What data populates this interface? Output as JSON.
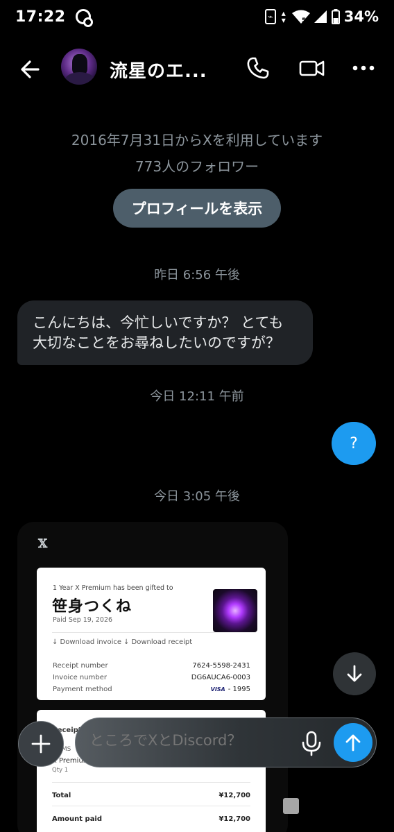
{
  "status_bar": {
    "time": "17:22",
    "network_badge": "5",
    "battery_label": "34%"
  },
  "header": {
    "title": "流星のエ...",
    "back_icon": "arrow-left-icon",
    "call_icon": "phone-icon",
    "video_icon": "video-camera-icon",
    "more_icon": "more-dots-icon"
  },
  "profile": {
    "since": "2016年7月31日からXを利用しています",
    "followers": "773人のフォロワー",
    "view_profile_label": "プロフィールを表示"
  },
  "messages": {
    "ts1": "昨日 6:56 午後",
    "incoming_line1": "こんにちは、今忙しいですか？ とても",
    "incoming_line2": "大切なことをお尋ねしたいのですが？",
    "ts2": "今日 12:11 午前",
    "outgoing": "?",
    "ts3": "今日 3:05 午後"
  },
  "receipt": {
    "logo": "𝕏",
    "gift_line": "1 Year X Premium has been gifted to",
    "recipient": "笹身つくね",
    "paid": "Paid Sep 19, 2026",
    "download_invoice": "↓  Download invoice",
    "download_receipt": "↓  Download receipt",
    "receipt_number_label": "Receipt number",
    "receipt_number": "7624-5598-2431",
    "invoice_number_label": "Invoice number",
    "invoice_number": "DG6AUCA6-0003",
    "payment_method_label": "Payment method",
    "payment_brand": "VISA",
    "payment_method": "- 1995",
    "receipt_title": "Receipt",
    "items_header": "ITEMS",
    "item_name": "X Premium",
    "item_qty": "Qty 1",
    "total_label": "Total",
    "total_value": "¥12,700",
    "amount_paid_label": "Amount paid",
    "amount_paid_value": "¥12,700"
  },
  "compose": {
    "placeholder": "ところでXとDiscord？"
  }
}
